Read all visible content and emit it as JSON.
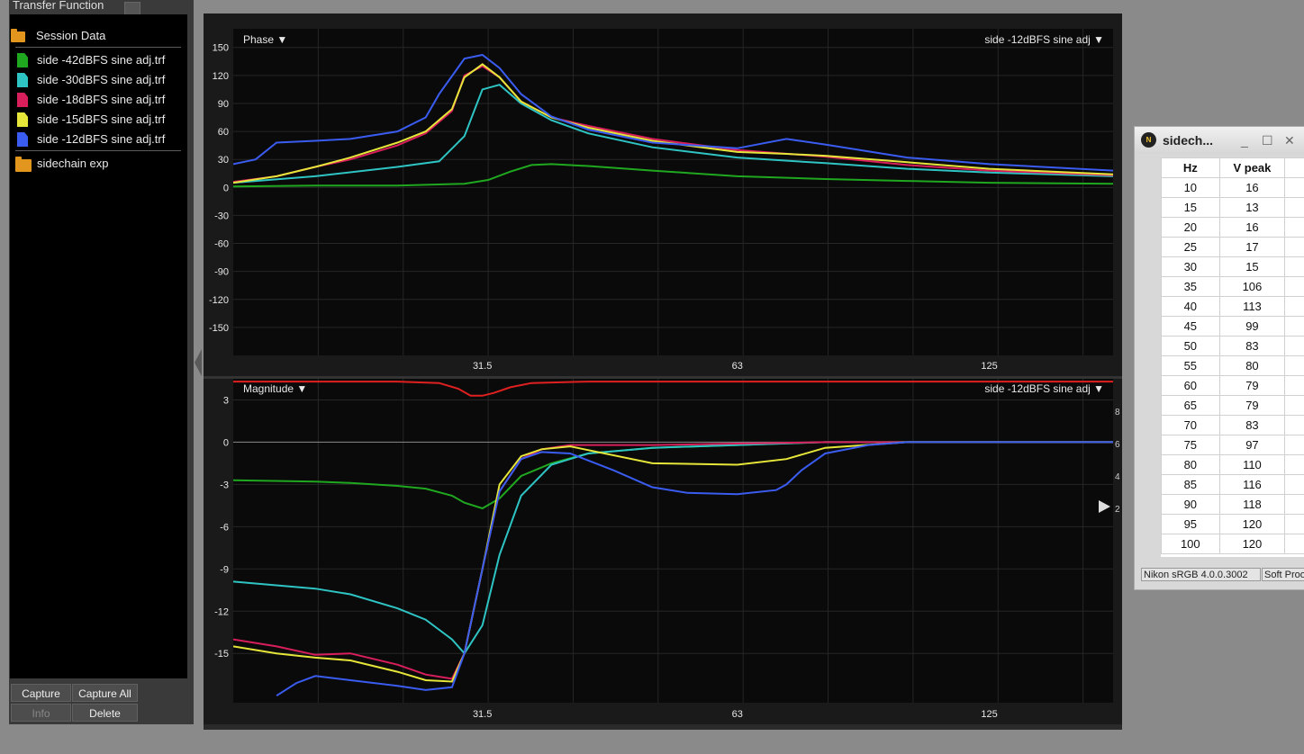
{
  "panel": {
    "title": "Transfer Function",
    "session_label": "Session Data",
    "files": [
      {
        "label": "side -42dBFS sine adj.trf",
        "color": "#1fa81f"
      },
      {
        "label": "side -30dBFS sine adj.trf",
        "color": "#2fc4c4"
      },
      {
        "label": "side -18dBFS sine adj.trf",
        "color": "#d81e5b"
      },
      {
        "label": "side -15dBFS sine adj.trf",
        "color": "#e6e63a"
      },
      {
        "label": "side -12dBFS sine adj.trf",
        "color": "#3a5cf0"
      }
    ],
    "folder_label": "sidechain exp",
    "buttons": {
      "capture": "Capture",
      "capture_all": "Capture All",
      "info": "Info",
      "delete": "Delete"
    }
  },
  "phase_panel": {
    "selector_label": "Phase ▼",
    "trace_label": "side -12dBFS sine adj ▼"
  },
  "magnitude_panel": {
    "selector_label": "Magnitude ▼",
    "trace_label": "side -12dBFS sine adj ▼",
    "coherence_axis_ticks": [
      "8",
      "6",
      "4",
      "2"
    ]
  },
  "chart_data": [
    {
      "type": "line",
      "title": "Phase",
      "x_scale": "log",
      "x_ticks": [
        31.5,
        63,
        125
      ],
      "xlim": [
        16,
        175
      ],
      "ylim": [
        -180,
        170
      ],
      "y_ticks": [
        150,
        120,
        90,
        60,
        30,
        0,
        -30,
        -60,
        -90,
        -120,
        -150
      ],
      "grid": true,
      "series": [
        {
          "name": "side -42dBFS sine adj.trf",
          "color": "#1fa81f",
          "x": [
            16,
            20,
            25,
            30,
            32,
            34,
            36,
            38,
            42,
            50,
            63,
            80,
            100,
            125,
            175
          ],
          "y": [
            1,
            2,
            2,
            4,
            8,
            17,
            24,
            25,
            23,
            18,
            12,
            9,
            7,
            5,
            4
          ]
        },
        {
          "name": "side -30dBFS sine adj.trf",
          "color": "#2fc4c4",
          "x": [
            16,
            20,
            25,
            28,
            30,
            31.5,
            33,
            35,
            38,
            42,
            50,
            63,
            80,
            100,
            125,
            175
          ],
          "y": [
            5,
            12,
            22,
            28,
            55,
            105,
            110,
            90,
            72,
            58,
            43,
            32,
            26,
            20,
            16,
            12
          ]
        },
        {
          "name": "side -18dBFS sine adj.trf",
          "color": "#d81e5b",
          "x": [
            16,
            18,
            20,
            22,
            25,
            27,
            29,
            30,
            31.5,
            33,
            35,
            38,
            42,
            50,
            63,
            80,
            100,
            125,
            175
          ],
          "y": [
            6,
            12,
            22,
            30,
            45,
            58,
            82,
            120,
            130,
            118,
            92,
            75,
            66,
            52,
            40,
            33,
            24,
            18,
            13
          ]
        },
        {
          "name": "side -15dBFS sine adj.trf",
          "color": "#e6e63a",
          "x": [
            16,
            18,
            20,
            22,
            25,
            27,
            29,
            30,
            31.5,
            33,
            35,
            38,
            42,
            50,
            63,
            72,
            80,
            100,
            125,
            175
          ],
          "y": [
            5,
            12,
            22,
            32,
            48,
            60,
            84,
            118,
            132,
            118,
            92,
            75,
            64,
            50,
            38,
            36,
            34,
            27,
            20,
            14
          ]
        },
        {
          "name": "side -12dBFS sine adj.trf",
          "color": "#3a5cf0",
          "x": [
            16,
            17,
            18,
            20,
            22,
            25,
            27,
            28,
            30,
            31.5,
            33,
            35,
            38,
            42,
            50,
            63,
            72,
            80,
            100,
            125,
            175
          ],
          "y": [
            25,
            30,
            48,
            50,
            52,
            60,
            75,
            100,
            138,
            142,
            128,
            100,
            76,
            62,
            48,
            42,
            52,
            46,
            32,
            25,
            18
          ]
        }
      ]
    },
    {
      "type": "line",
      "title": "Magnitude",
      "x_scale": "log",
      "x_ticks": [
        31.5,
        63,
        125
      ],
      "xlim": [
        16,
        175
      ],
      "ylim": [
        -18.5,
        4.5
      ],
      "y_ticks": [
        3,
        0,
        -3,
        -6,
        -9,
        -12,
        -15
      ],
      "grid": true,
      "series": [
        {
          "name": "coherence",
          "color": "#e02020",
          "x": [
            16,
            25,
            28,
            29.5,
            30.5,
            31.5,
            32.5,
            34,
            36,
            42,
            63,
            100,
            175
          ],
          "y": [
            4.3,
            4.3,
            4.2,
            3.8,
            3.3,
            3.3,
            3.5,
            3.9,
            4.2,
            4.3,
            4.3,
            4.3,
            4.3
          ]
        },
        {
          "name": "side -42dBFS sine adj.trf",
          "color": "#1fa81f",
          "x": [
            16,
            20,
            22,
            25,
            27,
            29,
            30,
            31.5,
            33,
            35,
            38,
            42,
            50,
            63,
            80,
            100,
            175
          ],
          "y": [
            -2.7,
            -2.8,
            -2.9,
            -3.1,
            -3.3,
            -3.8,
            -4.3,
            -4.7,
            -4.0,
            -2.4,
            -1.5,
            -0.8,
            -0.4,
            -0.2,
            0,
            0,
            0
          ]
        },
        {
          "name": "side -30dBFS sine adj.trf",
          "color": "#2fc4c4",
          "x": [
            16,
            20,
            22,
            25,
            27,
            29,
            30,
            31.5,
            33,
            35,
            38,
            42,
            50,
            63,
            80,
            100,
            175
          ],
          "y": [
            -9.9,
            -10.4,
            -10.8,
            -11.8,
            -12.6,
            -14.0,
            -15.0,
            -13.0,
            -8.0,
            -3.8,
            -1.6,
            -0.8,
            -0.4,
            -0.2,
            0,
            0,
            0
          ]
        },
        {
          "name": "side -18dBFS sine adj.trf",
          "color": "#d81e5b",
          "x": [
            16,
            18,
            20,
            22,
            25,
            27,
            29,
            30,
            31.5,
            33,
            35,
            37,
            40,
            50,
            63,
            80,
            100,
            175
          ],
          "y": [
            -14.0,
            -14.5,
            -15.1,
            -15.0,
            -15.8,
            -16.5,
            -16.8,
            -15.0,
            -9.0,
            -3.5,
            -1.2,
            -0.5,
            -0.2,
            -0.2,
            -0.1,
            0,
            0,
            0
          ]
        },
        {
          "name": "side -15dBFS sine adj.trf",
          "color": "#e6e63a",
          "x": [
            16,
            18,
            20,
            22,
            25,
            27,
            29,
            30,
            31.5,
            33,
            35,
            37,
            40,
            50,
            63,
            72,
            80,
            100,
            175
          ],
          "y": [
            -14.5,
            -15.0,
            -15.3,
            -15.5,
            -16.3,
            -16.9,
            -17.0,
            -15.0,
            -9.0,
            -3.0,
            -1.0,
            -0.5,
            -0.3,
            -1.5,
            -1.6,
            -1.2,
            -0.4,
            0,
            0
          ]
        },
        {
          "name": "side -12dBFS sine adj.trf",
          "color": "#3a5cf0",
          "x": [
            18,
            19,
            20,
            22,
            25,
            27,
            29,
            30,
            31.5,
            33,
            35,
            37,
            40,
            45,
            50,
            55,
            63,
            70,
            72,
            75,
            80,
            90,
            100,
            175
          ],
          "y": [
            -18.0,
            -17.1,
            -16.6,
            -16.9,
            -17.3,
            -17.6,
            -17.4,
            -15.0,
            -9.0,
            -3.5,
            -1.2,
            -0.7,
            -0.8,
            -2.0,
            -3.2,
            -3.6,
            -3.7,
            -3.4,
            -3.0,
            -2.0,
            -0.8,
            -0.2,
            0,
            0
          ]
        }
      ]
    }
  ],
  "side_window": {
    "title": "sidech...",
    "minimize": "_",
    "maximize": "☐",
    "close": "✕",
    "columns": [
      "Hz",
      "V peak"
    ],
    "rows": [
      [
        "10",
        "16"
      ],
      [
        "15",
        "13"
      ],
      [
        "20",
        "16"
      ],
      [
        "25",
        "17"
      ],
      [
        "30",
        "15"
      ],
      [
        "35",
        "106"
      ],
      [
        "40",
        "113"
      ],
      [
        "45",
        "99"
      ],
      [
        "50",
        "83"
      ],
      [
        "55",
        "80"
      ],
      [
        "60",
        "79"
      ],
      [
        "65",
        "79"
      ],
      [
        "70",
        "83"
      ],
      [
        "75",
        "97"
      ],
      [
        "80",
        "110"
      ],
      [
        "85",
        "116"
      ],
      [
        "90",
        "118"
      ],
      [
        "95",
        "120"
      ],
      [
        "100",
        "120"
      ]
    ],
    "status_profile": "Nikon sRGB 4.0.0.3002",
    "status_softproof": "Soft Proo"
  }
}
